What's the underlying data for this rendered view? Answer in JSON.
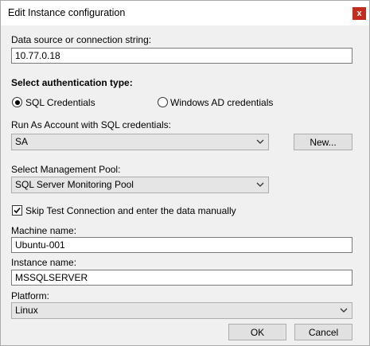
{
  "window": {
    "title": "Edit Instance configuration",
    "close_symbol": "x"
  },
  "data_source": {
    "label": "Data source or connection string:",
    "value": "10.77.0.18"
  },
  "auth": {
    "heading": "Select authentication type:",
    "options": [
      {
        "label": "SQL Credentials",
        "selected": true
      },
      {
        "label": "Windows AD credentials",
        "selected": false
      }
    ]
  },
  "run_as": {
    "label": "Run As Account with SQL credentials:",
    "selected": "SA",
    "new_button": "New..."
  },
  "management_pool": {
    "label": "Select Management Pool:",
    "selected": "SQL Server Monitoring Pool"
  },
  "skip_test": {
    "label": "Skip Test Connection and enter the data manually",
    "checked": true
  },
  "machine": {
    "label": "Machine name:",
    "value": "Ubuntu-001"
  },
  "instance": {
    "label": "Instance name:",
    "value": "MSSQLSERVER"
  },
  "platform": {
    "label": "Platform:",
    "selected": "Linux"
  },
  "buttons": {
    "ok": "OK",
    "cancel": "Cancel"
  }
}
